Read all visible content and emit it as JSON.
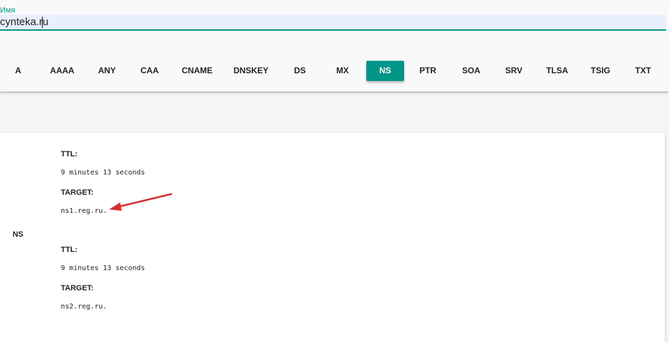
{
  "search": {
    "label": "Имя",
    "value": "cynteka.ru"
  },
  "tabs": [
    {
      "label": "A",
      "active": false
    },
    {
      "label": "AAAA",
      "active": false
    },
    {
      "label": "ANY",
      "active": false
    },
    {
      "label": "CAA",
      "active": false
    },
    {
      "label": "CNAME",
      "active": false
    },
    {
      "label": "DNSKEY",
      "active": false
    },
    {
      "label": "DS",
      "active": false
    },
    {
      "label": "MX",
      "active": false
    },
    {
      "label": "NS",
      "active": true
    },
    {
      "label": "PTR",
      "active": false
    },
    {
      "label": "SOA",
      "active": false
    },
    {
      "label": "SRV",
      "active": false
    },
    {
      "label": "TLSA",
      "active": false
    },
    {
      "label": "TSIG",
      "active": false
    },
    {
      "label": "TXT",
      "active": false
    }
  ],
  "colors": {
    "accent": "#009688",
    "annotation_arrow": "#d32f2f",
    "input_bg": "#e8f0fe"
  },
  "records": [
    {
      "type": "",
      "ttl_label": "TTL:",
      "ttl_value": "9 minutes 13 seconds",
      "target_label": "TARGET:",
      "target_value": "ns1.reg.ru."
    },
    {
      "type": "NS",
      "ttl_label": "TTL:",
      "ttl_value": "9 minutes 13 seconds",
      "target_label": "TARGET:",
      "target_value": "ns2.reg.ru."
    }
  ]
}
